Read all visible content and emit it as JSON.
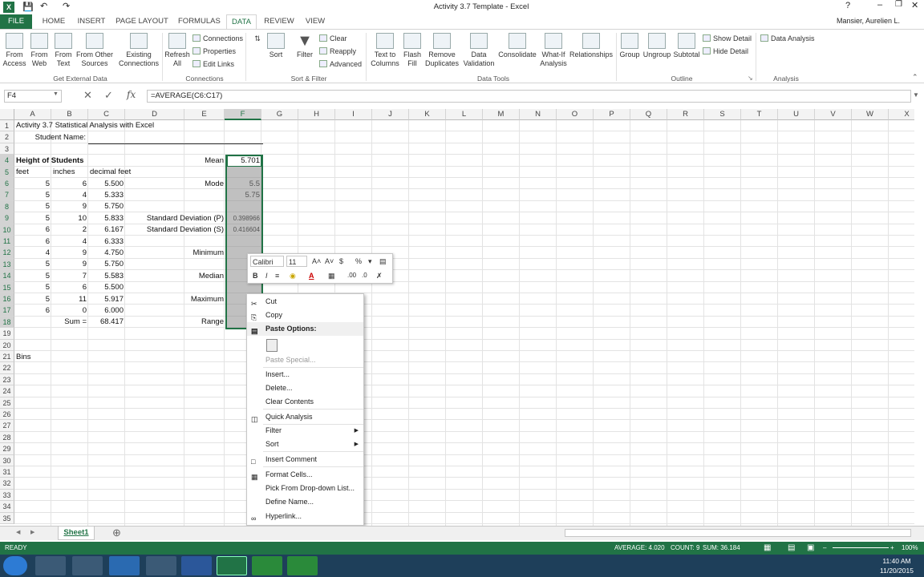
{
  "title_bar": {
    "title": "Activity 3.7 Template - Excel",
    "user": "Mansier, Aurelien L."
  },
  "ribbon_tabs": [
    "FILE",
    "HOME",
    "INSERT",
    "PAGE LAYOUT",
    "FORMULAS",
    "DATA",
    "REVIEW",
    "VIEW"
  ],
  "active_tab": "DATA",
  "ribbon": {
    "get_external": {
      "from_access": "From\nAccess",
      "from_web": "From\nWeb",
      "from_text": "From\nText",
      "from_other": "From Other\nSources",
      "existing": "Existing\nConnections",
      "label": "Get External Data"
    },
    "connections": {
      "refresh": "Refresh\nAll",
      "connections": "Connections",
      "properties": "Properties",
      "edit_links": "Edit Links",
      "label": "Connections"
    },
    "sort_filter": {
      "sort": "Sort",
      "filter": "Filter",
      "clear": "Clear",
      "reapply": "Reapply",
      "advanced": "Advanced",
      "label": "Sort & Filter"
    },
    "data_tools": {
      "text_to_columns": "Text to\nColumns",
      "flash_fill": "Flash\nFill",
      "remove_dup": "Remove\nDuplicates",
      "validation": "Data\nValidation",
      "consolidate": "Consolidate",
      "what_if": "What-If\nAnalysis",
      "relationships": "Relationships",
      "label": "Data Tools"
    },
    "outline": {
      "group": "Group",
      "ungroup": "Ungroup",
      "subtotal": "Subtotal",
      "show_detail": "Show Detail",
      "hide_detail": "Hide Detail",
      "label": "Outline"
    },
    "analysis": {
      "data_analysis": "Data Analysis",
      "label": "Analysis"
    }
  },
  "name_box": "F4",
  "formula": "=AVERAGE(C6:C17)",
  "columns": [
    "A",
    "B",
    "C",
    "D",
    "E",
    "F",
    "G",
    "H",
    "I",
    "J",
    "K",
    "L",
    "M",
    "N",
    "O",
    "P",
    "Q",
    "R",
    "S",
    "T",
    "U",
    "V",
    "W",
    "X"
  ],
  "rows": [
    "1",
    "2",
    "3",
    "4",
    "5",
    "6",
    "7",
    "8",
    "9",
    "10",
    "11",
    "12",
    "13",
    "14",
    "15",
    "16",
    "17",
    "18",
    "19",
    "20",
    "21",
    "22",
    "23",
    "24",
    "25",
    "26",
    "27",
    "28",
    "29",
    "30",
    "31",
    "32",
    "33",
    "34",
    "35"
  ],
  "cells": {
    "title": "Activity 3.7 Statistical Analysis with Excel",
    "student_name": "Student Name:",
    "height_hdr": "Height of Students",
    "col_feet": "feet",
    "col_inches": "inches",
    "col_decimal": "decimal feet",
    "feet": [
      "5",
      "5",
      "5",
      "5",
      "6",
      "6",
      "4",
      "5",
      "5",
      "5",
      "5",
      "6"
    ],
    "inches": [
      "6",
      "4",
      "9",
      "10",
      "2",
      "4",
      "9",
      "9",
      "7",
      "6",
      "11",
      "0"
    ],
    "decimal": [
      "5.500",
      "5.333",
      "5.750",
      "5.833",
      "6.167",
      "6.333",
      "4.750",
      "5.750",
      "5.583",
      "5.500",
      "5.917",
      "6.000"
    ],
    "sum_label": "Sum =",
    "sum_value": "68.417",
    "bins": "Bins",
    "labels": {
      "mean": "Mean",
      "mode": "Mode",
      "sdp": "Standard Deviation (P)",
      "sds": "Standard Deviation (S)",
      "min": "Minimum",
      "median": "Median",
      "max": "Maximum",
      "range": "Range"
    },
    "values": {
      "mean": "5.701",
      "mode_a": "5.5",
      "mode_b": "5.75",
      "sdp": "0.398966",
      "sds": "0.416604"
    }
  },
  "mini_toolbar": {
    "font": "Calibri",
    "size": "11"
  },
  "context_menu": [
    {
      "label": "Cut",
      "icon": "scissors-icon"
    },
    {
      "label": "Copy",
      "icon": "copy-icon"
    },
    {
      "label": "Paste Options:",
      "icon": "paste-icon"
    },
    {
      "label": "Paste Special...",
      "icon": ""
    },
    {
      "label": "Insert...",
      "icon": ""
    },
    {
      "label": "Delete...",
      "icon": ""
    },
    {
      "label": "Clear Contents",
      "icon": ""
    },
    {
      "label": "Quick Analysis",
      "icon": "quick-analysis-icon"
    },
    {
      "label": "Filter",
      "icon": ""
    },
    {
      "label": "Sort",
      "icon": ""
    },
    {
      "label": "Insert Comment",
      "icon": "comment-icon"
    },
    {
      "label": "Format Cells...",
      "icon": "format-cells-icon"
    },
    {
      "label": "Pick From Drop-down List...",
      "icon": ""
    },
    {
      "label": "Define Name...",
      "icon": ""
    },
    {
      "label": "Hyperlink...",
      "icon": "hyperlink-icon"
    }
  ],
  "sheet_tab": "Sheet1",
  "status": {
    "ready": "READY",
    "average": "AVERAGE: 4.020",
    "count": "COUNT: 9",
    "sum": "SUM: 36.184",
    "zoom": "100%"
  },
  "taskbar": {
    "time": "11:40 AM",
    "date": "11/20/2015"
  },
  "colors": {
    "excel_green": "#217346",
    "taskbar": "#1e3f5a"
  }
}
